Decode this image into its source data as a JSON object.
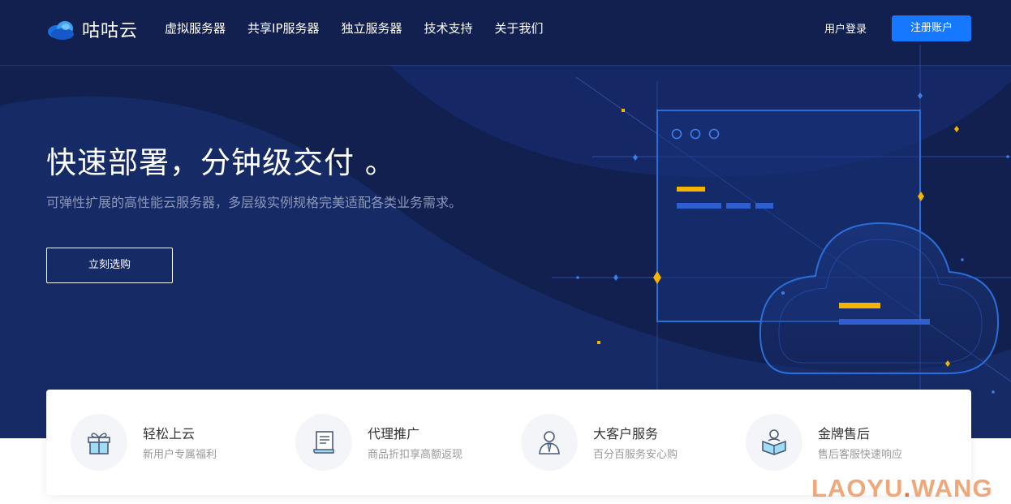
{
  "brand": {
    "name": "咕咕云"
  },
  "nav": {
    "items": [
      {
        "label": "虚拟服务器"
      },
      {
        "label": "共享IP服务器"
      },
      {
        "label": "独立服务器"
      },
      {
        "label": "技术支持"
      },
      {
        "label": "关于我们"
      }
    ],
    "login": "用户登录",
    "register": "注册账户"
  },
  "hero": {
    "title": "快速部署，分钟级交付 。",
    "subtitle": "可弹性扩展的高性能云服务器，多层级实例规格完美适配各类业务需求。",
    "cta": "立刻选购"
  },
  "features": [
    {
      "title": "轻松上云",
      "desc": "新用户专属福利",
      "icon": "gift-icon"
    },
    {
      "title": "代理推广",
      "desc": "商品折扣享高额返现",
      "icon": "document-icon"
    },
    {
      "title": "大客户服务",
      "desc": "百分百服务安心购",
      "icon": "person-icon"
    },
    {
      "title": "金牌售后",
      "desc": "售后客服快速响应",
      "icon": "support-icon"
    }
  ],
  "watermark": {
    "left": "LAOYU",
    "dot": ".",
    "right": "WANG"
  },
  "colors": {
    "hero_bg": "#122050",
    "accent": "#1677ff",
    "highlight": "#f5b400"
  }
}
